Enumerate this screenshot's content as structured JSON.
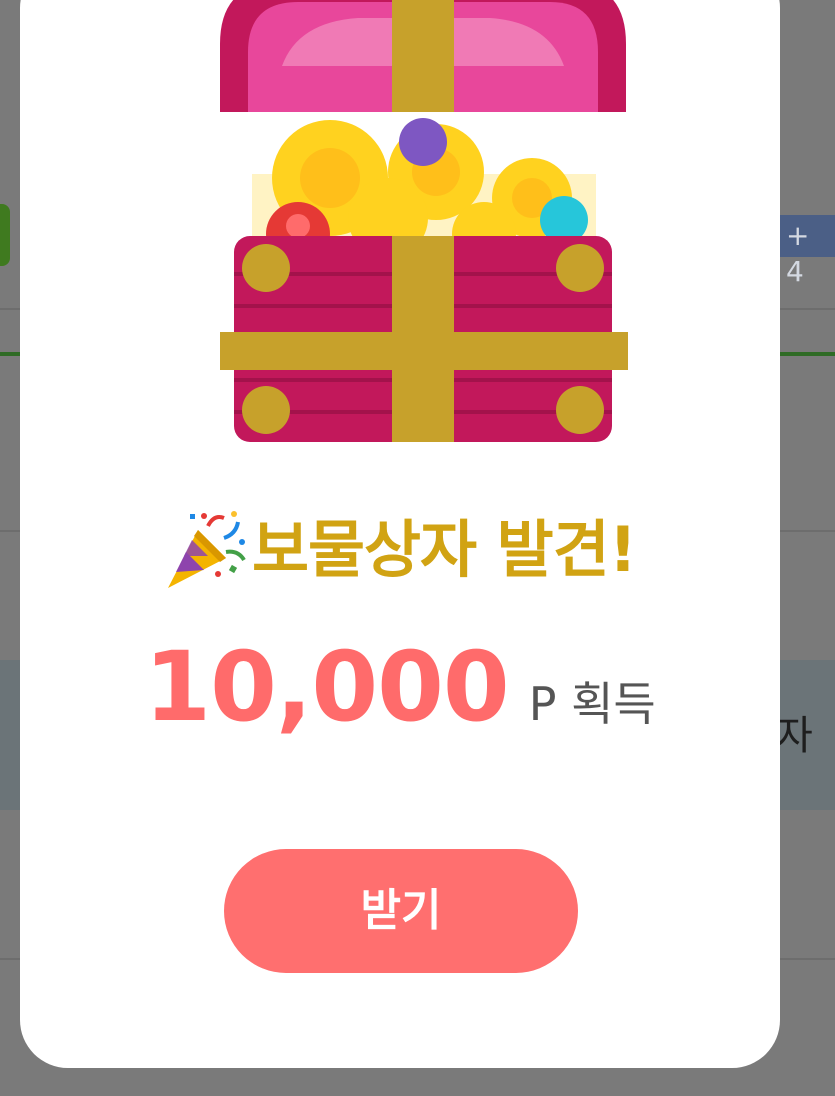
{
  "background": {
    "partial_badge_text": "+ 4",
    "partial_row_char": "자"
  },
  "modal": {
    "title": "보물상자 발견!",
    "reward_amount": "10,000",
    "reward_unit": "P 획득",
    "receive_button_label": "받기"
  },
  "icons": {
    "title_icon": "party-popper-icon",
    "hero_image": "treasure-chest-icon"
  },
  "colors": {
    "title": "#d1a313",
    "reward_amount": "#ff6b6b",
    "button": "#ff6f6f",
    "chest": "#c2185b",
    "chest_band": "#c7a12b"
  }
}
